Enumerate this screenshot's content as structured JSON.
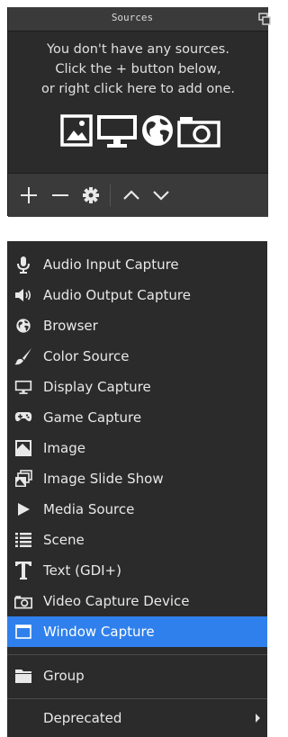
{
  "dock": {
    "title": "Sources",
    "empty_line1": "You don't have any sources.",
    "empty_line2": "Click the + button below,",
    "empty_line3": "or right click here to add one.",
    "toolbar": [
      "add-icon",
      "remove-icon",
      "gear-icon",
      "move-up-icon",
      "move-down-icon"
    ]
  },
  "menu": {
    "items": [
      {
        "label": "Audio Input Capture",
        "icon": "microphone-icon"
      },
      {
        "label": "Audio Output Capture",
        "icon": "speaker-icon"
      },
      {
        "label": "Browser",
        "icon": "globe-icon"
      },
      {
        "label": "Color Source",
        "icon": "paintbrush-icon"
      },
      {
        "label": "Display Capture",
        "icon": "monitor-icon"
      },
      {
        "label": "Game Capture",
        "icon": "gamepad-icon"
      },
      {
        "label": "Image",
        "icon": "image-icon"
      },
      {
        "label": "Image Slide Show",
        "icon": "slideshow-icon"
      },
      {
        "label": "Media Source",
        "icon": "play-icon"
      },
      {
        "label": "Scene",
        "icon": "list-icon"
      },
      {
        "label": "Text (GDI+)",
        "icon": "text-icon"
      },
      {
        "label": "Video Capture Device",
        "icon": "camera-icon"
      },
      {
        "label": "Window Capture",
        "icon": "window-icon",
        "selected": true
      }
    ],
    "group_label": "Group",
    "deprecated_label": "Deprecated"
  },
  "colors": {
    "background": "#2b2b2b",
    "highlight": "#2f80ec",
    "text": "#e8e8e8"
  }
}
